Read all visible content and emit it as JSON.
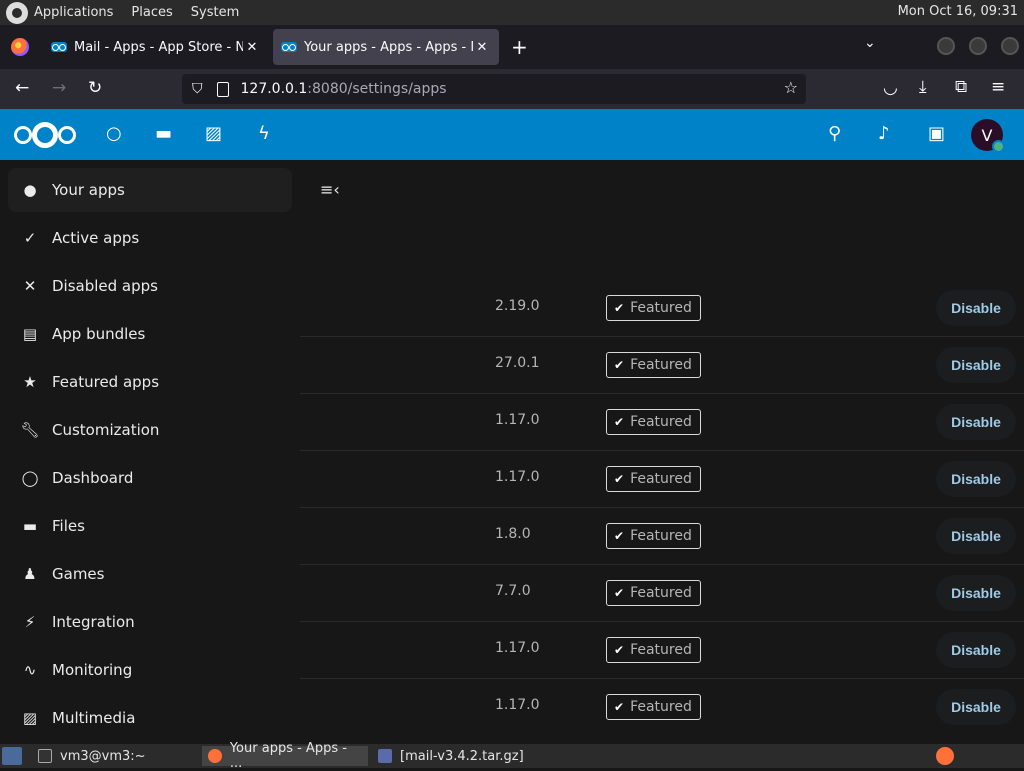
{
  "gnome_panel": {
    "menus": [
      "Applications",
      "Places",
      "System"
    ],
    "clock": "Mon Oct 16, 09:31"
  },
  "browser": {
    "tabs": [
      {
        "title": "Mail - Apps - App Store - Ne",
        "active": false
      },
      {
        "title": "Your apps - Apps - Apps - N",
        "active": true
      }
    ],
    "url_host": "127.0.0.1",
    "url_rest": ":8080/settings/apps"
  },
  "nextcloud": {
    "avatar_initial": "V",
    "accent_color": "#0082c9"
  },
  "sidebar": {
    "items": [
      {
        "label": "Your apps",
        "icon": "user-icon",
        "active": true
      },
      {
        "label": "Active apps",
        "icon": "check-icon",
        "active": false
      },
      {
        "label": "Disabled apps",
        "icon": "close-icon",
        "active": false
      },
      {
        "label": "App bundles",
        "icon": "archive-icon",
        "active": false
      },
      {
        "label": "Featured apps",
        "icon": "star-icon",
        "active": false
      },
      {
        "label": "Customization",
        "icon": "wrench-icon",
        "active": false
      },
      {
        "label": "Dashboard",
        "icon": "circle-icon",
        "active": false
      },
      {
        "label": "Files",
        "icon": "folder-icon",
        "active": false
      },
      {
        "label": "Games",
        "icon": "joystick-icon",
        "active": false
      },
      {
        "label": "Integration",
        "icon": "plug-icon",
        "active": false
      },
      {
        "label": "Monitoring",
        "icon": "pulse-icon",
        "active": false
      },
      {
        "label": "Multimedia",
        "icon": "image-icon",
        "active": false
      }
    ]
  },
  "apps": {
    "featured_label": "Featured",
    "disable_label": "Disable",
    "rows": [
      {
        "version": "2.19.0"
      },
      {
        "version": "27.0.1"
      },
      {
        "version": "1.17.0"
      },
      {
        "version": "1.17.0"
      },
      {
        "version": "1.8.0"
      },
      {
        "version": "7.7.0"
      },
      {
        "version": "1.17.0"
      },
      {
        "version": "1.17.0"
      }
    ]
  },
  "taskbar": {
    "items": [
      {
        "label": "vm3@vm3:~"
      },
      {
        "label": "Your apps - Apps - ..."
      },
      {
        "label": "[mail-v3.4.2.tar.gz]"
      }
    ]
  }
}
